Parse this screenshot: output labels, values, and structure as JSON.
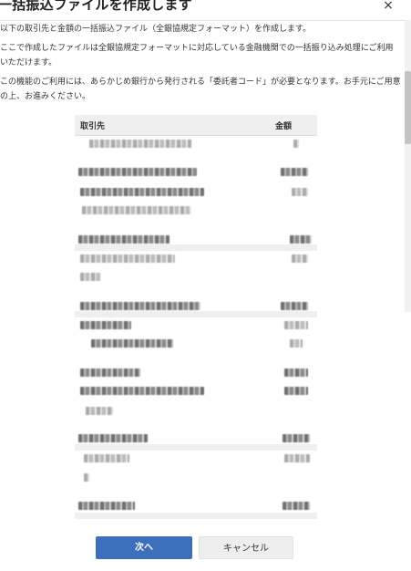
{
  "dialog": {
    "title": "一括振込ファイルを作成します",
    "close_symbol": "×",
    "paragraph1": "以下の取引先と金額の一括振込ファイル（全銀協規定フォーマット）を作成します。",
    "paragraph2": "ここで作成したファイルは全銀協規定フォーマットに対応している金融機関での一括振り込み処理にご利用いただけます。",
    "paragraph3": "この機能のご利用には、あらかじめ銀行から発行される「委託者コード」が必要となります。お手元にご用意の上、お進みください。"
  },
  "table": {
    "columns": [
      "取引先",
      "金額"
    ]
  },
  "buttons": {
    "next_label": "次へ",
    "cancel_label": "キャンセル"
  },
  "icons": {
    "close": "close-icon"
  }
}
